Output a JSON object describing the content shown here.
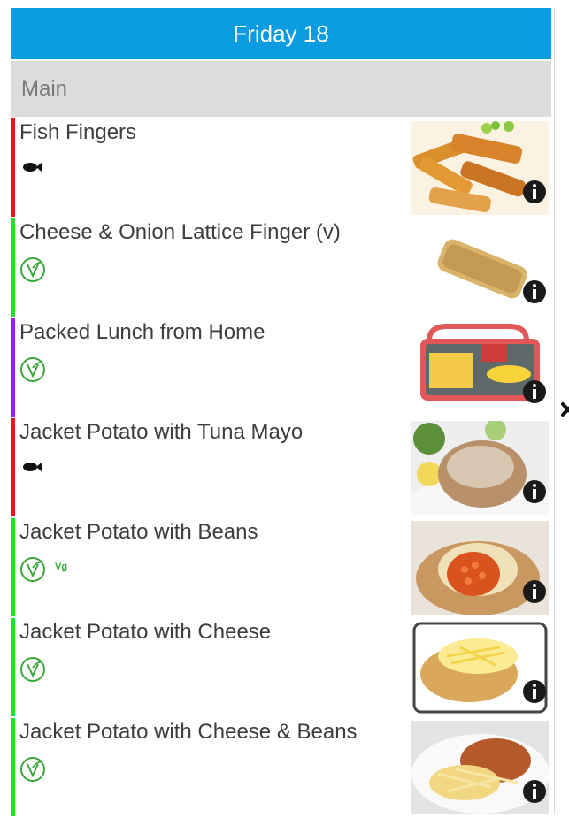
{
  "header": {
    "title": "Friday 18",
    "color": "#0a9be0"
  },
  "section": {
    "label": "Main"
  },
  "items": [
    {
      "title": "Fish Fingers",
      "bar_color": "#e8181a",
      "icons": [
        "fish-icon"
      ],
      "image": "fish-fingers"
    },
    {
      "title": "Cheese & Onion Lattice Finger (v)",
      "bar_color": "#22e02a",
      "icons": [
        "vegetarian-icon"
      ],
      "image": "lattice-finger"
    },
    {
      "title": "Packed Lunch from Home",
      "bar_color": "#9b1fe8",
      "icons": [
        "vegetarian-icon"
      ],
      "image": "lunch-box"
    },
    {
      "title": "Jacket Potato with Tuna Mayo",
      "bar_color": "#e8181a",
      "icons": [
        "fish-icon"
      ],
      "image": "tuna-potato"
    },
    {
      "title": "Jacket Potato with Beans",
      "bar_color": "#22e02a",
      "icons": [
        "vegetarian-icon",
        "vegan-badge"
      ],
      "vegan_label": "Vg",
      "image": "beans-potato"
    },
    {
      "title": "Jacket Potato with Cheese",
      "bar_color": "#22e02a",
      "icons": [
        "vegetarian-icon"
      ],
      "image": "cheese-potato"
    },
    {
      "title": "Jacket Potato with Cheese & Beans",
      "bar_color": "#22e02a",
      "icons": [
        "vegetarian-icon"
      ],
      "image": "cheese-beans-potato"
    }
  ]
}
